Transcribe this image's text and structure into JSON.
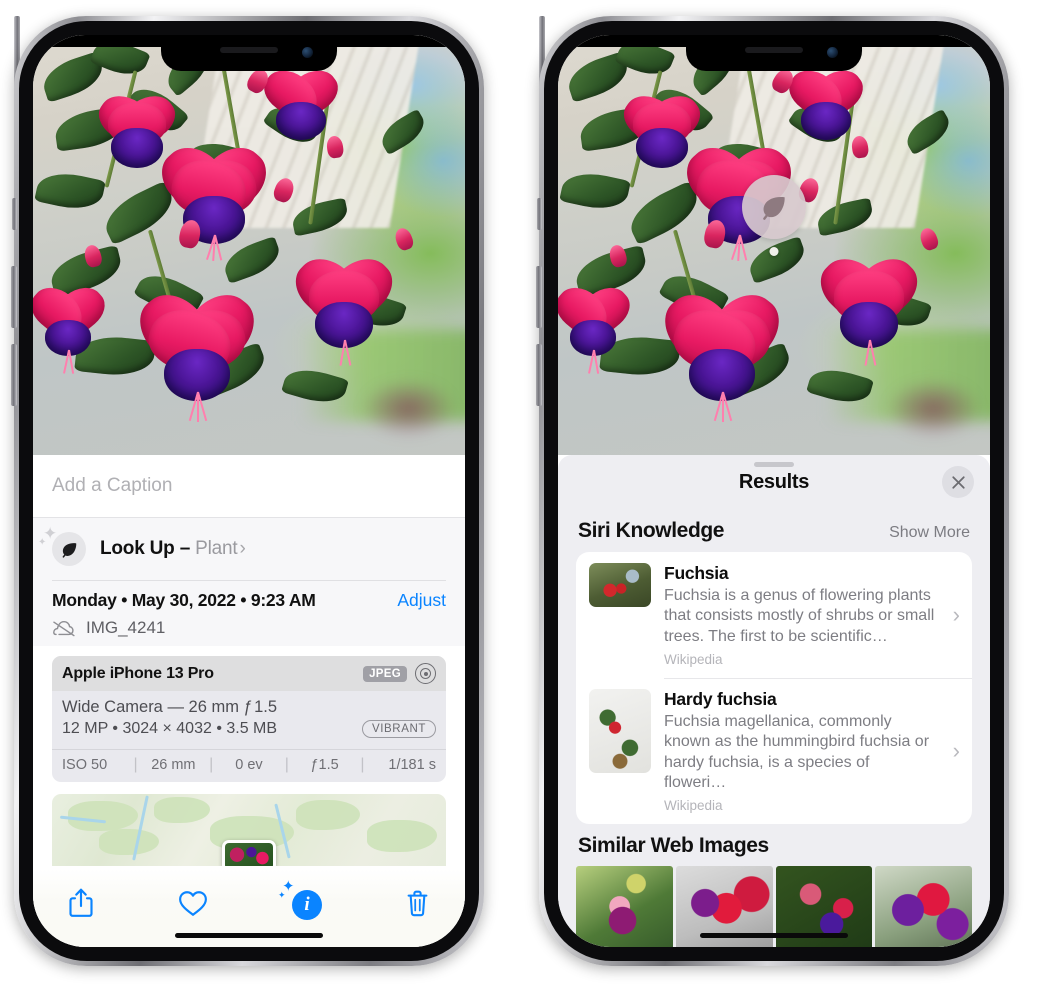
{
  "left_phone": {
    "caption_placeholder": "Add a Caption",
    "lookup": {
      "icon": "leaf-icon",
      "label": "Look Up",
      "dash": "–",
      "subject": "Plant",
      "chevron": "›"
    },
    "metadata": {
      "date_line": "Monday • May 30, 2022 • 9:23 AM",
      "adjust_label": "Adjust",
      "filename": "IMG_4241",
      "cloud_icon": "cloud-slash-icon"
    },
    "exif": {
      "device": "Apple iPhone 13 Pro",
      "format_badge": "JPEG",
      "raw_icon": "raw-lens-icon",
      "lens_line": "Wide Camera — 26 mm ƒ 1.5",
      "size_line": "12 MP • 3024 × 4032 • 3.5 MB",
      "style_badge": "VIBRANT",
      "stats": [
        "ISO 50",
        "26 mm",
        "0 ev",
        "ƒ1.5",
        "1/181 s"
      ]
    },
    "toolbar": {
      "share_icon": "share-icon",
      "favorite_icon": "heart-icon",
      "info_icon": "visual-lookup-info-icon",
      "delete_icon": "trash-icon"
    }
  },
  "right_phone": {
    "visual_lookup_badge": "leaf-icon",
    "sheet": {
      "title": "Results",
      "close_icon": "close-icon"
    },
    "siri_knowledge": {
      "title": "Siri Knowledge",
      "show_more": "Show More",
      "items": [
        {
          "title": "Fuchsia",
          "description": "Fuchsia is a genus of flowering plants that consists mostly of shrubs or small trees. The first to be scientific…",
          "source": "Wikipedia",
          "chevron": "›"
        },
        {
          "title": "Hardy fuchsia",
          "description": "Fuchsia magellanica, commonly known as the hummingbird fuchsia or hardy fuchsia, is a species of floweri…",
          "source": "Wikipedia",
          "chevron": "›"
        }
      ]
    },
    "similar_web_images": {
      "title": "Similar Web Images",
      "count": 4
    }
  },
  "colors": {
    "accent_blue": "#0a84ff",
    "sheet_bg": "#eeeef2",
    "card_bg": "#ffffff",
    "secondary_text": "#7d7d83",
    "tertiary_text": "#b4b4b9"
  }
}
